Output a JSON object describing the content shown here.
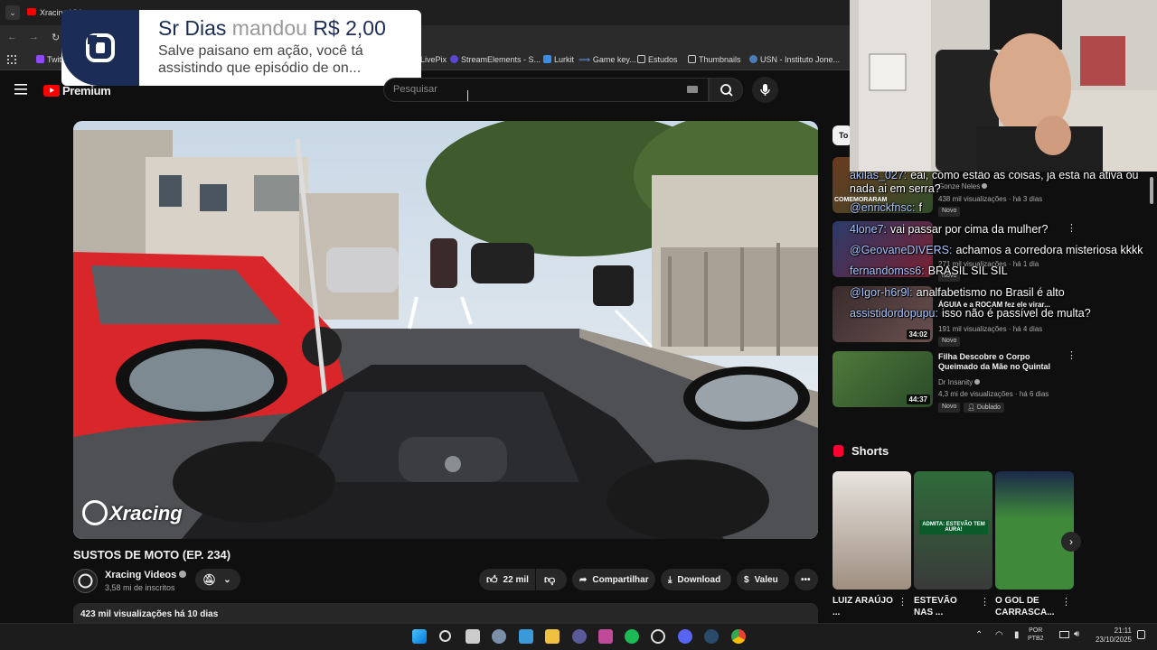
{
  "browser": {
    "tab_title": "Xracing Videos",
    "bookmarks": [
      "Twit",
      "LivePix",
      "StreamElements - S...",
      "Lurkit",
      "Game key...",
      "Estudos",
      "Thumbnails",
      "USN - Instituto Jone..."
    ]
  },
  "donation": {
    "name": "Sr Dias",
    "verb": "mandou",
    "amount": "R$ 2,00",
    "message": "Salve paisano em ação, você tá assistindo que episódio de on..."
  },
  "header": {
    "logo": "Premium",
    "search_placeholder": "Pesquisar"
  },
  "video": {
    "watermark": "Xracing",
    "title": "SUSTOS DE MOTO (EP. 234)",
    "channel": "Xracing Videos",
    "subscribers": "3,58 mi de inscritos",
    "likes": "22 mil",
    "share": "Compartilhar",
    "download": "Download",
    "thanks": "Valeu",
    "views": "423 mil visualizações  há 10 dias"
  },
  "sidebar": {
    "chip": "To",
    "videos": [
      {
        "channel": "Gonze Neles",
        "meta": "438 mil visualizações · há 3 dias",
        "badge": "Novo",
        "thumb_text": "COMEMORARAM"
      },
      {
        "title": "",
        "meta": "271 mil visualizações · há 1 dia",
        "badge": "Novo"
      },
      {
        "title": "ÁGUIA e a ROCAM fez ele virar...",
        "meta": "191 mil visualizações · há 4 dias",
        "badge": "Novo",
        "duration": "34:02"
      },
      {
        "title": "Filha Descobre o Corpo Queimado da Mãe no Quintal",
        "channel": "Dr Insanity",
        "meta": "4,3 mi de visualizações · há 6 dias",
        "badge": "Novo",
        "badge2": "Dublado",
        "duration": "44:37"
      }
    ]
  },
  "chat": [
    {
      "user": "akilas_027:",
      "text": "eai, como estão as coisas, já está na ativa ou"
    },
    {
      "user": "",
      "text": "nada ai em serra?"
    },
    {
      "user": "@enrickfnsc:",
      "text": "f"
    },
    {
      "user": "4lone7:",
      "text": "vai passar por cima da mulher?"
    },
    {
      "user": "@GeovaneDIVERS:",
      "text": "achamos a corredora misteriosa kkkk"
    },
    {
      "user": "fernandomss6:",
      "text": "BRASIL SIL SIL"
    },
    {
      "user": "@Igor-h6r9l:",
      "text": "analfabetismo no Brasil é alto"
    },
    {
      "user": "assistidordopupu:",
      "text": "isso não é passível de multa?"
    }
  ],
  "shorts": {
    "heading": "Shorts",
    "items": [
      {
        "title": "LUIZ ARAÚJO ..."
      },
      {
        "title": "ESTEVÃO NAS ..."
      },
      {
        "title": "O GOL DE CARRASCA..."
      }
    ],
    "thumb2_text": "ADMITA: ESTEVÃO TEM AURA!"
  },
  "taskbar": {
    "lang": "POR",
    "layout": "PTB2",
    "time": "21:11",
    "date": "23/10/2025"
  }
}
